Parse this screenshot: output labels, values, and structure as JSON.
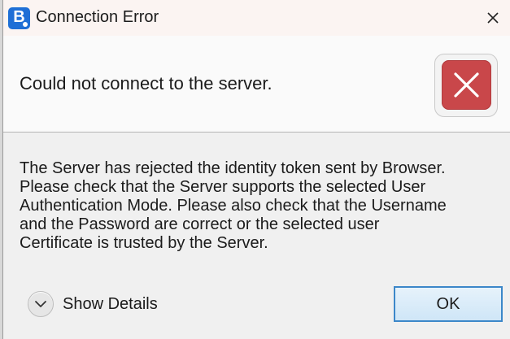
{
  "dialog": {
    "title": "Connection Error",
    "app_icon_letter": "B",
    "header_message": "Could not connect to the server.",
    "body_lines": [
      "The Server has rejected the identity token sent by Browser.",
      "Please check that the Server supports the selected User",
      "Authentication Mode. Please also check that the Username",
      "and the Password are correct or the selected user",
      "Certificate is trusted by the Server."
    ],
    "details_label": "Show Details",
    "ok_label": "OK"
  },
  "icons": {
    "app": "app-logo-icon",
    "close": "close-icon",
    "error": "error-x-icon",
    "chevron": "chevron-down-icon"
  },
  "colors": {
    "title_bar": "#fbf4f2",
    "error_red": "#c9474a",
    "button_border": "#3c87c9",
    "app_blue": "#1f6fd6"
  }
}
